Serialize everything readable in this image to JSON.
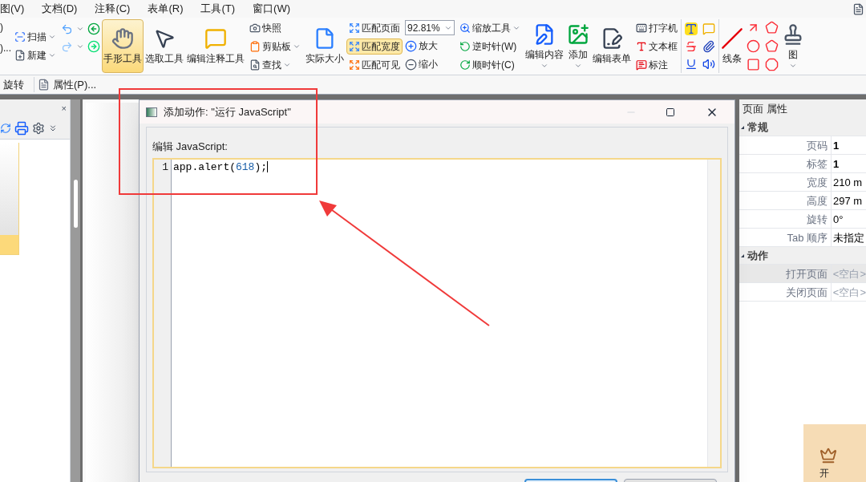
{
  "menu_bar": {
    "items": [
      "图(V)",
      "文档(D)",
      "注释(C)",
      "表单(R)",
      "工具(T)",
      "窗口(W)"
    ]
  },
  "ribbon": {
    "cut_labels": [
      ")",
      ")..."
    ],
    "groups": [
      {
        "kind": "stack",
        "items": [
          {
            "label": "扫描",
            "dropdown": true
          },
          {
            "label": "新建",
            "dropdown": true
          }
        ]
      },
      {
        "kind": "history-icons"
      },
      {
        "kind": "large",
        "items": [
          {
            "label": "手形工具",
            "selected": true
          },
          {
            "label": "选取工具",
            "selected": false
          },
          {
            "label": "编辑注释工具",
            "selected": false
          }
        ]
      },
      {
        "kind": "stack",
        "items": [
          {
            "label": "快照",
            "dropdown": false
          },
          {
            "label": "剪贴板",
            "dropdown": true
          },
          {
            "label": "查找",
            "dropdown": true
          }
        ]
      },
      {
        "kind": "large",
        "items": [
          {
            "label": "实际大小",
            "selected": false
          }
        ]
      },
      {
        "kind": "stack",
        "items": [
          {
            "label": "匹配页面",
            "dropdown": false,
            "selected": false
          },
          {
            "label": "匹配宽度",
            "dropdown": false,
            "selected": true
          },
          {
            "label": "匹配可见",
            "dropdown": false,
            "selected": false
          }
        ]
      },
      {
        "kind": "zoom",
        "value": "92.81%",
        "items": [
          {
            "label": "放大"
          },
          {
            "label": "缩小"
          }
        ]
      },
      {
        "kind": "stack",
        "items": [
          {
            "label": "缩放工具",
            "dropdown": true
          },
          {
            "label": "逆时针(W)",
            "dropdown": false
          },
          {
            "label": "顺时针(C)",
            "dropdown": false
          }
        ]
      },
      {
        "kind": "large",
        "items": [
          {
            "label": "编辑内容",
            "selected": false,
            "dropdown": true
          },
          {
            "label": "添加",
            "selected": false,
            "dropdown": true
          },
          {
            "label": "编辑表单",
            "selected": false
          }
        ]
      },
      {
        "kind": "stack",
        "items": [
          {
            "label": "打字机",
            "dropdown": false
          },
          {
            "label": "文本框",
            "dropdown": false
          },
          {
            "label": "标注",
            "dropdown": false
          }
        ]
      },
      {
        "kind": "markup-icons"
      },
      {
        "kind": "large",
        "items": [
          {
            "label": "线条",
            "selected": false
          }
        ]
      },
      {
        "kind": "shape-icons"
      },
      {
        "kind": "large",
        "items": [
          {
            "label": "图",
            "selected": false,
            "dropdown": true
          }
        ]
      }
    ]
  },
  "toolbar": {
    "items": [
      "旋转",
      "属性(P)..."
    ]
  },
  "dialog": {
    "title": "添加动作: \"运行 JavaScript\"",
    "label": "编辑 JavaScript:",
    "lines": [
      {
        "number": "1",
        "code": "app.alert(618);"
      }
    ]
  },
  "properties_panel": {
    "title": "页面 属性",
    "sections": [
      {
        "title": "常规",
        "expanded": true,
        "rows": [
          {
            "label": "页码",
            "value": "1",
            "bold": true,
            "selected": false
          },
          {
            "label": "标签",
            "value": "1",
            "bold": true,
            "selected": false
          },
          {
            "label": "宽度",
            "value": "210 m",
            "bold": false,
            "selected": false
          },
          {
            "label": "高度",
            "value": "297 m",
            "bold": false,
            "selected": false
          },
          {
            "label": "旋转",
            "value": "0°",
            "bold": false,
            "selected": false
          },
          {
            "label": "Tab 顺序",
            "value": "未指定",
            "bold": false,
            "selected": false
          }
        ]
      },
      {
        "title": "动作",
        "expanded": true,
        "rows": [
          {
            "label": "打开页面",
            "value": "<空白>",
            "bold": false,
            "selected": true
          },
          {
            "label": "关闭页面",
            "value": "<空白>",
            "bold": false,
            "selected": false
          }
        ]
      }
    ]
  },
  "left_panel": {
    "close": "×"
  },
  "vip_banner": {
    "text": "开"
  }
}
